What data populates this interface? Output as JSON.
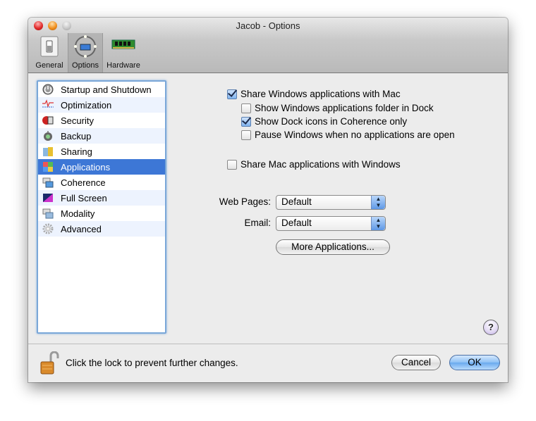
{
  "window": {
    "title": "Jacob - Options"
  },
  "toolbar": {
    "items": [
      {
        "label": "General",
        "icon": "switch-icon",
        "selected": false
      },
      {
        "label": "Options",
        "icon": "options-icon",
        "selected": true
      },
      {
        "label": "Hardware",
        "icon": "ram-chip-icon",
        "selected": false
      }
    ]
  },
  "sidebar": {
    "items": [
      {
        "label": "Startup and Shutdown",
        "icon": "power-icon"
      },
      {
        "label": "Optimization",
        "icon": "optimization-icon"
      },
      {
        "label": "Security",
        "icon": "security-icon"
      },
      {
        "label": "Backup",
        "icon": "backup-icon"
      },
      {
        "label": "Sharing",
        "icon": "sharing-folder-icon"
      },
      {
        "label": "Applications",
        "icon": "applications-icon",
        "selected": true
      },
      {
        "label": "Coherence",
        "icon": "coherence-icon"
      },
      {
        "label": "Full Screen",
        "icon": "full-screen-icon"
      },
      {
        "label": "Modality",
        "icon": "modality-icon"
      },
      {
        "label": "Advanced",
        "icon": "gear-icon"
      }
    ]
  },
  "main": {
    "share_windows_apps": {
      "label": "Share Windows applications with Mac",
      "checked": true
    },
    "show_apps_folder": {
      "label": "Show Windows applications folder in Dock",
      "checked": false
    },
    "show_dock_icons": {
      "label": "Show Dock icons in Coherence only",
      "checked": true
    },
    "pause_windows": {
      "label": "Pause Windows when no applications are open",
      "checked": false
    },
    "share_mac_apps": {
      "label": "Share Mac applications with Windows",
      "checked": false
    },
    "web_pages": {
      "label": "Web Pages:",
      "value": "Default"
    },
    "email": {
      "label": "Email:",
      "value": "Default"
    },
    "more_apps_button": "More Applications..."
  },
  "help": {
    "label": "?"
  },
  "footer": {
    "lock_text": "Click the lock to prevent further changes.",
    "cancel": "Cancel",
    "ok": "OK"
  },
  "colors": {
    "selection": "#3d77d6",
    "default_button": "#6aa9ee"
  }
}
